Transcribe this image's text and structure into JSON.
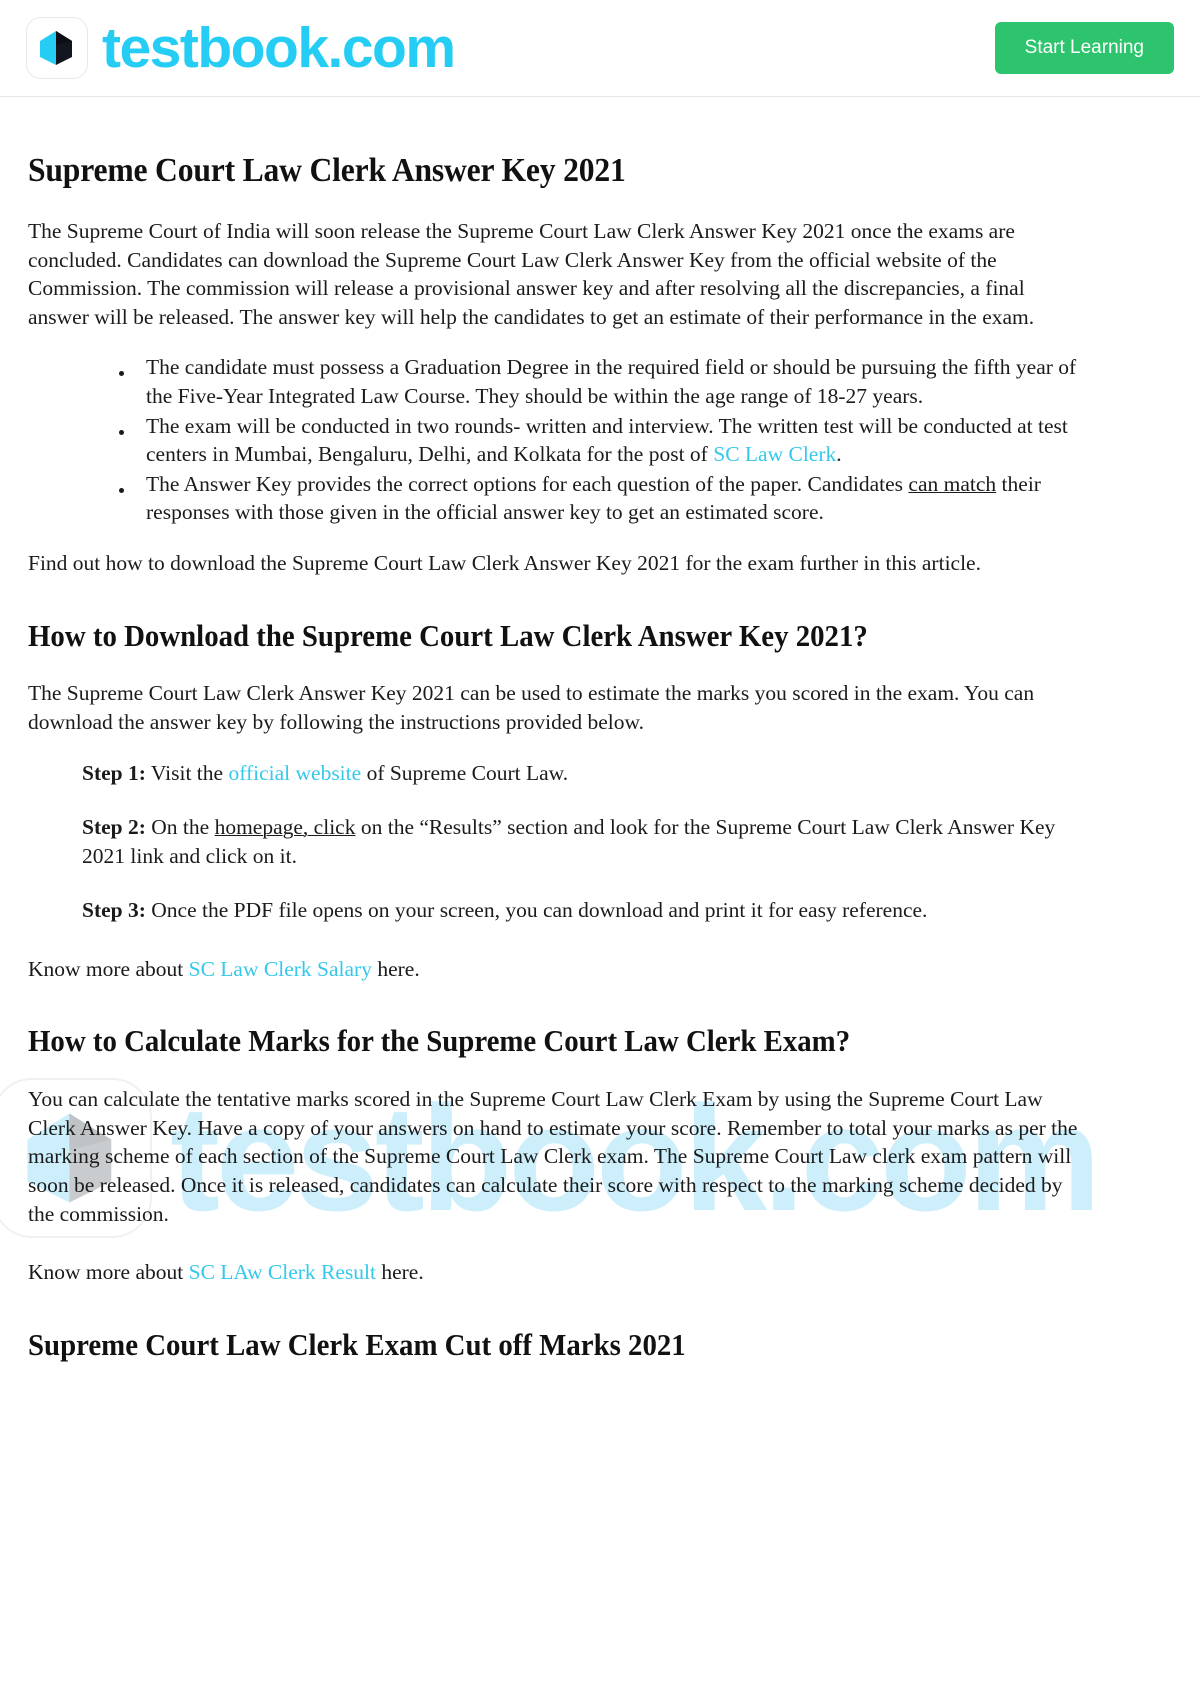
{
  "header": {
    "logo_icon": "open-book-icon",
    "brand_name": "testbook.com",
    "cta_label": "Start Learning"
  },
  "watermark": {
    "icon": "open-book-icon",
    "text": "testbook.com"
  },
  "article": {
    "title": "Supreme Court Law Clerk Answer Key 2021",
    "intro": "The Supreme Court of India will soon release the Supreme Court Law Clerk Answer Key 2021 once the exams are concluded. Candidates can download the Supreme Court Law Clerk Answer Key from the official website of the Commission. The commission will release a provisional answer key and after resolving all the discrepancies, a final answer will be released. The answer key will help the candidates to get an estimate of their performance in the exam.",
    "bullets": [
      {
        "text_before": "The candidate must possess a Graduation Degree in the required field or should be pursuing the fifth year of the Five-Year Integrated Law Course. They should be within the age range of 18-27 years.",
        "link_text": "",
        "text_after": ""
      },
      {
        "text_before": "The exam will be conducted in two rounds- written and interview. The written test will be conducted at test centers in Mumbai, Bengaluru, Delhi, and Kolkata for the post of ",
        "link_text": "SC Law Clerk",
        "text_after": "."
      },
      {
        "text_before": "The Answer Key provides the correct options for each question of the paper. Candidates ",
        "underlined_text": "can match",
        "text_after": " their responses with those given in the official answer key to get an estimated score."
      }
    ],
    "after_bullets": "Find out how to download the Supreme Court Law Clerk Answer Key 2021 for the exam further in this article.",
    "section2": {
      "heading": "How to Download the Supreme Court Law Clerk Answer Key 2021?",
      "paragraph": "The Supreme Court Law Clerk Answer Key 2021 can be used to estimate the marks you scored in the exam. You can download the answer key by following the instructions provided below.",
      "steps": [
        {
          "label": "Step 1:",
          "text_before": " Visit the ",
          "link_text": "official website",
          "text_after": " of Supreme Court Law."
        },
        {
          "label": "Step 2:",
          "text_before": " On the ",
          "underlined_text": "homepage, click",
          "text_after": " on the “Results” section and look for the Supreme Court Law Clerk Answer Key 2021 link and click on it."
        },
        {
          "label": "Step 3:",
          "text_before": " Once the PDF file opens on your screen, you can download and print it for easy reference.",
          "link_text": "",
          "text_after": ""
        }
      ],
      "know_more_prefix": "Know more about ",
      "know_more_link": "SC Law Clerk Salary",
      "know_more_suffix": " here."
    },
    "section3": {
      "heading": "How to Calculate Marks for the Supreme Court Law Clerk Exam?",
      "paragraph": "You can calculate the tentative marks scored in the Supreme Court Law Clerk Exam by using the Supreme Court Law Clerk Answer Key. Have a copy of your answers on hand to estimate your score. Remember to total your marks as per the marking scheme of each section of the Supreme Court Law Clerk exam. The Supreme Court Law clerk exam pattern will soon be released. Once it is released, candidates can calculate their score with respect to the marking scheme decided by the commission.",
      "know_more_prefix": "Know more about ",
      "know_more_link": "SC LAw Clerk Result",
      "know_more_suffix": " here."
    },
    "section4": {
      "heading": "Supreme Court Law Clerk Exam Cut off Marks 2021"
    }
  },
  "colors": {
    "brand_cyan": "#25cdf5",
    "link_cyan": "#35c8ea",
    "cta_green": "#2dc46d",
    "watermark_cyan": "#cdeffb",
    "logo_dark": "#14161f"
  }
}
